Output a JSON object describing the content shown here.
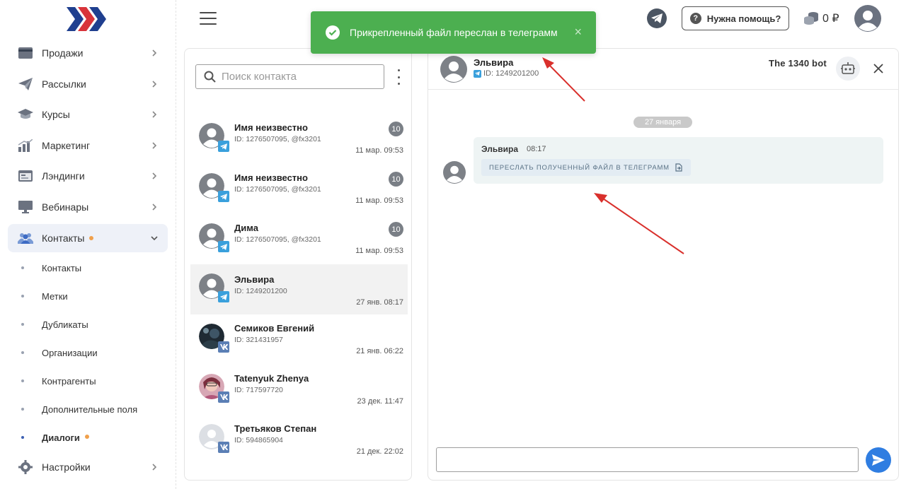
{
  "sidebar": {
    "items": [
      {
        "label": "Продажи"
      },
      {
        "label": "Рассылки"
      },
      {
        "label": "Курсы"
      },
      {
        "label": "Маркетинг"
      },
      {
        "label": "Лэндинги"
      },
      {
        "label": "Вебинары"
      },
      {
        "label": "Контакты"
      },
      {
        "label": "Настройки"
      }
    ],
    "subitems": [
      {
        "label": "Контакты"
      },
      {
        "label": "Метки"
      },
      {
        "label": "Дубликаты"
      },
      {
        "label": "Организации"
      },
      {
        "label": "Контрагенты"
      },
      {
        "label": "Дополнительные поля"
      },
      {
        "label": "Диалоги"
      }
    ]
  },
  "header": {
    "help_label": "Нужна помощь?",
    "balance": "0 ₽"
  },
  "toast": {
    "message": "Прикрепленный файл переслан в телеграмм",
    "close": "×"
  },
  "contacts": {
    "search_placeholder": "Поиск контакта",
    "list": [
      {
        "name": "Имя неизвестно",
        "id": "ID: 1276507095, @fx3201",
        "count": "10",
        "time": "11 мар. 09:53",
        "network": "telegram"
      },
      {
        "name": "Имя неизвестно",
        "id": "ID: 1276507095, @fx3201",
        "count": "10",
        "time": "11 мар. 09:53",
        "network": "telegram"
      },
      {
        "name": "Дима",
        "id": "ID: 1276507095, @fx3201",
        "count": "10",
        "time": "11 мар. 09:53",
        "network": "telegram"
      },
      {
        "name": "Эльвира",
        "id": "ID: 1249201200",
        "count": "",
        "time": "27 янв. 08:17",
        "network": "telegram"
      },
      {
        "name": "Семиков Евгений",
        "id": "ID: 321431957",
        "count": "",
        "time": "21 янв. 06:22",
        "network": "vk"
      },
      {
        "name": "Tatenyuk Zhenya",
        "id": "ID: 717597720",
        "count": "",
        "time": "23 дек. 11:47",
        "network": "vk"
      },
      {
        "name": "Третьяков Степан",
        "id": "ID: 594865904",
        "count": "",
        "time": "21 дек. 22:02",
        "network": "vk"
      }
    ]
  },
  "chat": {
    "name": "Эльвира",
    "id": "ID: 1249201200",
    "bot": "The 1340 bot",
    "date": "27 января",
    "message": {
      "author": "Эльвира",
      "time": "08:17",
      "button": "ПЕРЕСЛАТЬ ПОЛУЧЕННЫЙ ФАЙЛ В ТЕЛЕГРАММ"
    },
    "input_value": ""
  },
  "colors": {
    "toast": "#4caf50",
    "accent": "#2f7de1",
    "telegram": "#3aa0dc",
    "vk": "#5b7fb5",
    "dot": "#f0a04b",
    "arrow": "#d9302c"
  }
}
